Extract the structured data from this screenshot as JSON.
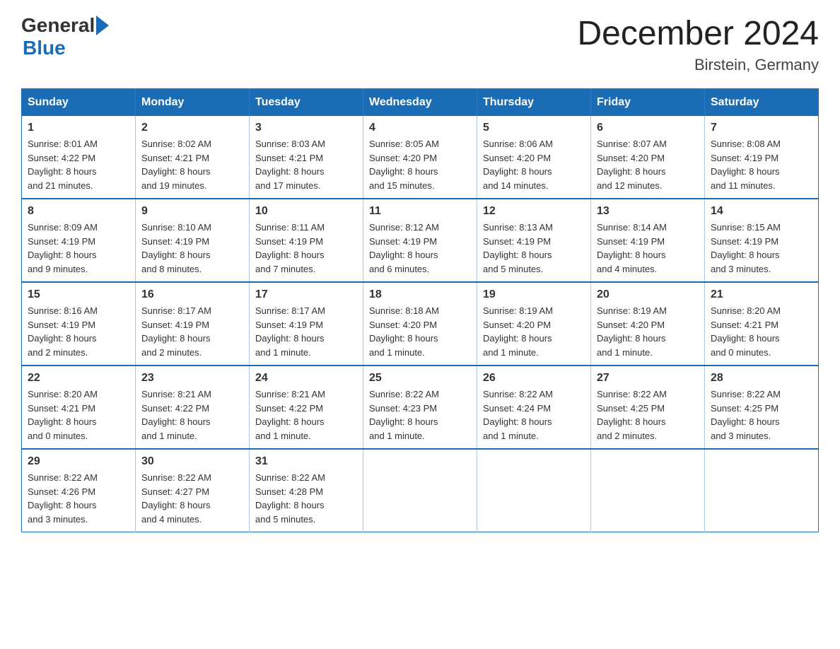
{
  "header": {
    "logo_general": "General",
    "logo_blue": "Blue",
    "title": "December 2024",
    "subtitle": "Birstein, Germany"
  },
  "days_of_week": [
    "Sunday",
    "Monday",
    "Tuesday",
    "Wednesday",
    "Thursday",
    "Friday",
    "Saturday"
  ],
  "weeks": [
    [
      {
        "day": "1",
        "sunrise": "8:01 AM",
        "sunset": "4:22 PM",
        "daylight": "8 hours and 21 minutes."
      },
      {
        "day": "2",
        "sunrise": "8:02 AM",
        "sunset": "4:21 PM",
        "daylight": "8 hours and 19 minutes."
      },
      {
        "day": "3",
        "sunrise": "8:03 AM",
        "sunset": "4:21 PM",
        "daylight": "8 hours and 17 minutes."
      },
      {
        "day": "4",
        "sunrise": "8:05 AM",
        "sunset": "4:20 PM",
        "daylight": "8 hours and 15 minutes."
      },
      {
        "day": "5",
        "sunrise": "8:06 AM",
        "sunset": "4:20 PM",
        "daylight": "8 hours and 14 minutes."
      },
      {
        "day": "6",
        "sunrise": "8:07 AM",
        "sunset": "4:20 PM",
        "daylight": "8 hours and 12 minutes."
      },
      {
        "day": "7",
        "sunrise": "8:08 AM",
        "sunset": "4:19 PM",
        "daylight": "8 hours and 11 minutes."
      }
    ],
    [
      {
        "day": "8",
        "sunrise": "8:09 AM",
        "sunset": "4:19 PM",
        "daylight": "8 hours and 9 minutes."
      },
      {
        "day": "9",
        "sunrise": "8:10 AM",
        "sunset": "4:19 PM",
        "daylight": "8 hours and 8 minutes."
      },
      {
        "day": "10",
        "sunrise": "8:11 AM",
        "sunset": "4:19 PM",
        "daylight": "8 hours and 7 minutes."
      },
      {
        "day": "11",
        "sunrise": "8:12 AM",
        "sunset": "4:19 PM",
        "daylight": "8 hours and 6 minutes."
      },
      {
        "day": "12",
        "sunrise": "8:13 AM",
        "sunset": "4:19 PM",
        "daylight": "8 hours and 5 minutes."
      },
      {
        "day": "13",
        "sunrise": "8:14 AM",
        "sunset": "4:19 PM",
        "daylight": "8 hours and 4 minutes."
      },
      {
        "day": "14",
        "sunrise": "8:15 AM",
        "sunset": "4:19 PM",
        "daylight": "8 hours and 3 minutes."
      }
    ],
    [
      {
        "day": "15",
        "sunrise": "8:16 AM",
        "sunset": "4:19 PM",
        "daylight": "8 hours and 2 minutes."
      },
      {
        "day": "16",
        "sunrise": "8:17 AM",
        "sunset": "4:19 PM",
        "daylight": "8 hours and 2 minutes."
      },
      {
        "day": "17",
        "sunrise": "8:17 AM",
        "sunset": "4:19 PM",
        "daylight": "8 hours and 1 minute."
      },
      {
        "day": "18",
        "sunrise": "8:18 AM",
        "sunset": "4:20 PM",
        "daylight": "8 hours and 1 minute."
      },
      {
        "day": "19",
        "sunrise": "8:19 AM",
        "sunset": "4:20 PM",
        "daylight": "8 hours and 1 minute."
      },
      {
        "day": "20",
        "sunrise": "8:19 AM",
        "sunset": "4:20 PM",
        "daylight": "8 hours and 1 minute."
      },
      {
        "day": "21",
        "sunrise": "8:20 AM",
        "sunset": "4:21 PM",
        "daylight": "8 hours and 0 minutes."
      }
    ],
    [
      {
        "day": "22",
        "sunrise": "8:20 AM",
        "sunset": "4:21 PM",
        "daylight": "8 hours and 0 minutes."
      },
      {
        "day": "23",
        "sunrise": "8:21 AM",
        "sunset": "4:22 PM",
        "daylight": "8 hours and 1 minute."
      },
      {
        "day": "24",
        "sunrise": "8:21 AM",
        "sunset": "4:22 PM",
        "daylight": "8 hours and 1 minute."
      },
      {
        "day": "25",
        "sunrise": "8:22 AM",
        "sunset": "4:23 PM",
        "daylight": "8 hours and 1 minute."
      },
      {
        "day": "26",
        "sunrise": "8:22 AM",
        "sunset": "4:24 PM",
        "daylight": "8 hours and 1 minute."
      },
      {
        "day": "27",
        "sunrise": "8:22 AM",
        "sunset": "4:25 PM",
        "daylight": "8 hours and 2 minutes."
      },
      {
        "day": "28",
        "sunrise": "8:22 AM",
        "sunset": "4:25 PM",
        "daylight": "8 hours and 3 minutes."
      }
    ],
    [
      {
        "day": "29",
        "sunrise": "8:22 AM",
        "sunset": "4:26 PM",
        "daylight": "8 hours and 3 minutes."
      },
      {
        "day": "30",
        "sunrise": "8:22 AM",
        "sunset": "4:27 PM",
        "daylight": "8 hours and 4 minutes."
      },
      {
        "day": "31",
        "sunrise": "8:22 AM",
        "sunset": "4:28 PM",
        "daylight": "8 hours and 5 minutes."
      },
      null,
      null,
      null,
      null
    ]
  ],
  "labels": {
    "sunrise": "Sunrise:",
    "sunset": "Sunset:",
    "daylight": "Daylight:"
  }
}
